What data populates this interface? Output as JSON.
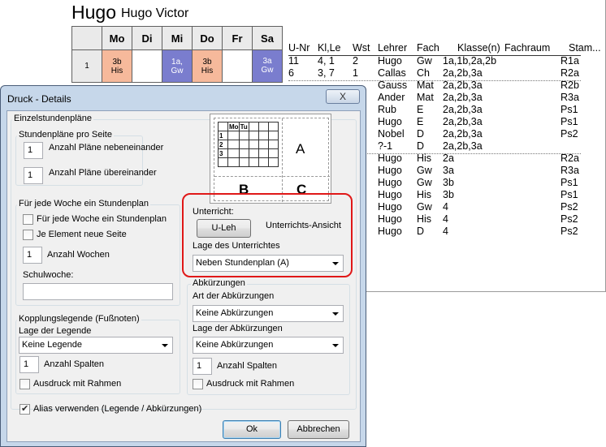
{
  "report": {
    "title": "Hugo",
    "subtitle": "Hugo Victor",
    "days": [
      "Mo",
      "Di",
      "Mi",
      "Do",
      "Fr",
      "Sa"
    ],
    "row1_label": "1",
    "cell_mo": [
      "3b",
      "His"
    ],
    "cell_mi": [
      "1a,",
      "Gw"
    ],
    "cell_do": [
      "3b",
      "His"
    ],
    "cell_sa": [
      "3a",
      "Gw"
    ],
    "list_headers": [
      "U-Nr",
      "Kl,Le",
      "Wst",
      "Lehrer",
      "Fach",
      "Klasse(n)",
      "Fachraum",
      "Stam..."
    ],
    "list_rows": [
      [
        "11",
        "4, 1",
        "2",
        "Hugo",
        "Gw",
        "1a,1b,2a,2b",
        "R1a"
      ],
      [
        "6",
        "3, 7",
        "1",
        "Callas",
        "Ch",
        "2a,2b,3a",
        "R2a"
      ],
      [
        "",
        "",
        "",
        "Gauss",
        "Mat",
        "2a,2b,3a",
        "R2b"
      ],
      [
        "",
        "",
        "",
        "Ander",
        "Mat",
        "2a,2b,3a",
        "R3a"
      ],
      [
        "",
        "",
        "",
        "Rub",
        "E",
        "2a,2b,3a",
        "Ps1"
      ],
      [
        "",
        "",
        "",
        "Hugo",
        "E",
        "2a,2b,3a",
        "Ps1"
      ],
      [
        "",
        "",
        "",
        "Nobel",
        "D",
        "2a,2b,3a",
        "Ps2"
      ],
      [
        "",
        "",
        "",
        "?-1",
        "D",
        "2a,2b,3a",
        ""
      ],
      [
        "",
        "",
        "",
        "Hugo",
        "His",
        "2a",
        "R2a"
      ],
      [
        "",
        "",
        "",
        "Hugo",
        "Gw",
        "3a",
        "R3a"
      ],
      [
        "",
        "",
        "",
        "Hugo",
        "Gw",
        "3b",
        "Ps1"
      ],
      [
        "",
        "",
        "",
        "Hugo",
        "His",
        "3b",
        "Ps1"
      ],
      [
        "",
        "",
        "",
        "Hugo",
        "Gw",
        "4",
        "Ps2"
      ],
      [
        "",
        "",
        "",
        "Hugo",
        "His",
        "4",
        "Ps2"
      ],
      [
        "",
        "",
        "",
        "Hugo",
        "D",
        "4",
        "Ps2"
      ]
    ]
  },
  "dialog": {
    "title": "Druck - Details",
    "close_symbol": "X",
    "section_title": "Einzelstundenpläne",
    "per_page": {
      "label": "Stundenpläne pro Seite",
      "side_value": "1",
      "side_label": "Anzahl Pläne nebeneinander",
      "stack_value": "1",
      "stack_label": "Anzahl Pläne übereinander"
    },
    "week": {
      "label": "Für jede Woche ein Stundenplan",
      "cb1_label": "Für jede Woche ein Stundenplan",
      "cb1_checked": false,
      "cb2_label": "Je Element neue Seite",
      "cb2_checked": false,
      "weeks_value": "1",
      "weeks_label": "Anzahl Wochen",
      "schoolweek_label": "Schulwoche:",
      "schoolweek_value": ""
    },
    "preview": {
      "head": [
        "Mo",
        "Tu"
      ],
      "rows": [
        "1",
        "2",
        "3"
      ],
      "a": "A",
      "b": "B",
      "c": "C"
    },
    "unterricht": {
      "label": "Unterricht:",
      "button": "U-Leh",
      "view_label": "Unterrichts-Ansicht",
      "position_label": "Lage des Unterrichtes",
      "position_value": "Neben Stundenplan (A)"
    },
    "legend": {
      "label": "Kopplungslegende (Fußnoten)",
      "position_label": "Lage der Legende",
      "position_value": "Keine Legende",
      "columns_value": "1",
      "columns_label": "Anzahl Spalten",
      "frame_label": "Ausdruck mit Rahmen",
      "frame_checked": false
    },
    "abbrev": {
      "label": "Abkürzungen",
      "type_label": "Art der Abkürzungen",
      "type_value": "Keine Abkürzungen",
      "position_label": "Lage der Abkürzungen",
      "position_value": "Keine Abkürzungen",
      "columns_value": "1",
      "columns_label": "Anzahl Spalten",
      "frame_label": "Ausdruck mit Rahmen",
      "frame_checked": false
    },
    "alias_label": "Alias verwenden (Legende / Abkürzungen)",
    "alias_checked": true,
    "ok": "Ok",
    "cancel": "Abbrechen"
  },
  "colors": {
    "salmon": "#f6b99b",
    "blue": "#7a7dce",
    "highlight": "#e01818"
  }
}
